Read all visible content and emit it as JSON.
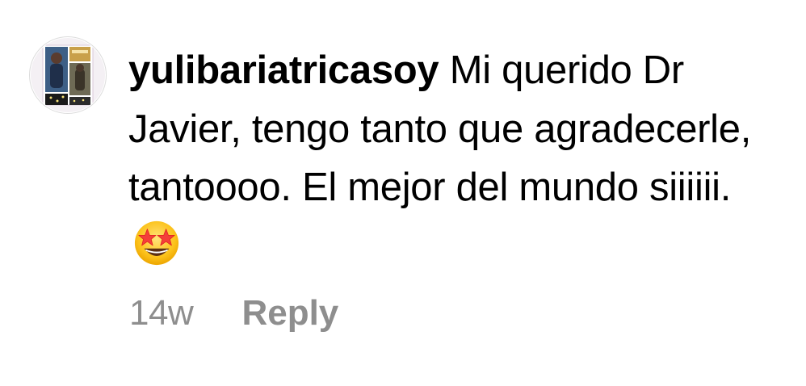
{
  "comment": {
    "username": "yulibariatricasoy",
    "text": "Mi querido Dr Javier, tengo tanto que agradecerle, tantoooo. El mejor del mundo siiiiii.",
    "emoji": "star-struck-emoji",
    "timestamp": "14w",
    "reply_label": "Reply"
  },
  "avatar": {
    "icon": "user-avatar"
  },
  "colors": {
    "text": "#000000",
    "muted": "#8e8e8e",
    "background": "#ffffff"
  }
}
